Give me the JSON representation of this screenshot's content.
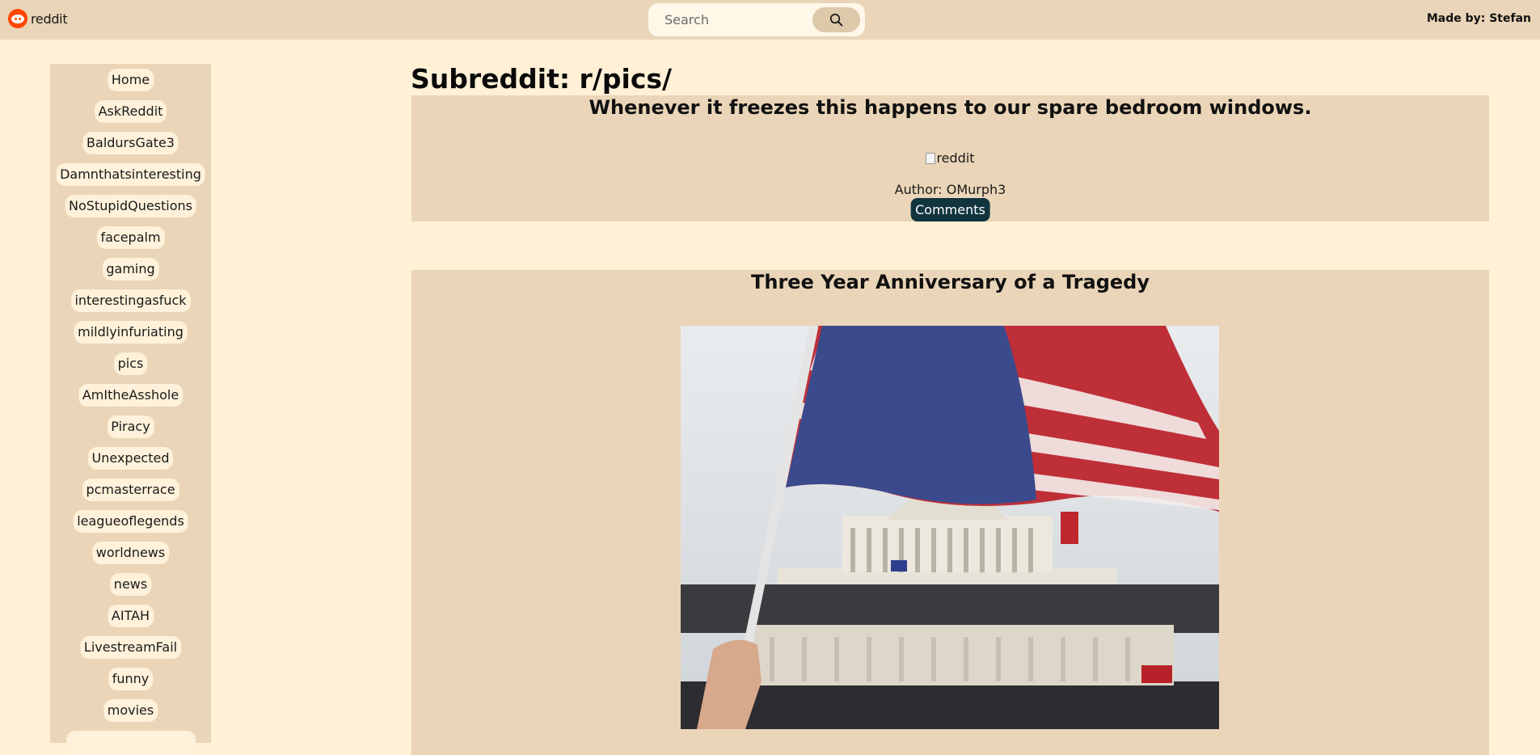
{
  "header": {
    "logo_text": "reddit",
    "search_placeholder": "Search",
    "made_by": "Made by: Stefan"
  },
  "sidebar": {
    "items": [
      {
        "label": "Home"
      },
      {
        "label": "AskReddit"
      },
      {
        "label": "BaldursGate3"
      },
      {
        "label": "Damnthatsinteresting"
      },
      {
        "label": "NoStupidQuestions"
      },
      {
        "label": "facepalm"
      },
      {
        "label": "gaming"
      },
      {
        "label": "interestingasfuck"
      },
      {
        "label": "mildlyinfuriating"
      },
      {
        "label": "pics"
      },
      {
        "label": "AmItheAsshole"
      },
      {
        "label": "Piracy"
      },
      {
        "label": "Unexpected"
      },
      {
        "label": "pcmasterrace"
      },
      {
        "label": "leagueoflegends"
      },
      {
        "label": "worldnews"
      },
      {
        "label": "news"
      },
      {
        "label": "AITAH"
      },
      {
        "label": "LivestreamFail"
      },
      {
        "label": "funny"
      },
      {
        "label": "movies"
      }
    ]
  },
  "main": {
    "title": "Subreddit: r/pics/",
    "posts": [
      {
        "title": "Whenever it freezes this happens to our spare bedroom windows.",
        "image_alt": "reddit",
        "author": "Author: OMurph3",
        "comments_label": "Comments"
      },
      {
        "title": "Three Year Anniversary of a Tragedy"
      }
    ]
  },
  "colors": {
    "page_bg": "#fff0d6",
    "panel_bg": "#ead5b8",
    "accent": "#ff4500",
    "button_dark": "#11343f"
  }
}
